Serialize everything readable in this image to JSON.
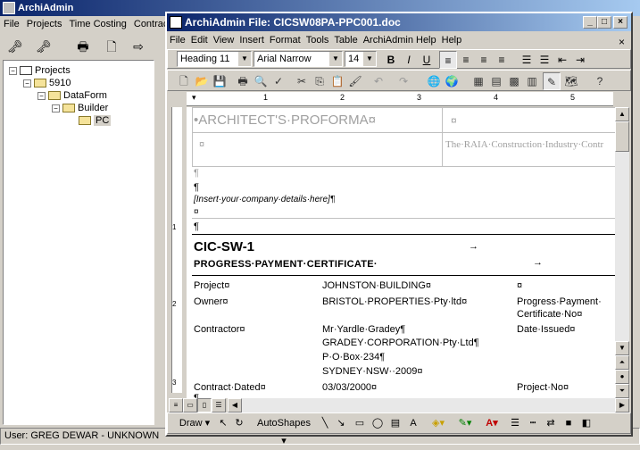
{
  "app": {
    "title": "ArchiAdmin",
    "menu": [
      "File",
      "Projects",
      "Time Costing",
      "Contract"
    ],
    "status": "User: GREG DEWAR - UNKNOWN"
  },
  "tree": {
    "items": [
      {
        "label": "Projects",
        "level": 0,
        "expander": "−"
      },
      {
        "label": "5910",
        "level": 1,
        "expander": "−"
      },
      {
        "label": "DataForm",
        "level": 2,
        "expander": "−"
      },
      {
        "label": "Builder",
        "level": 3,
        "expander": "−"
      },
      {
        "label": "PC",
        "level": 4,
        "expander": ""
      }
    ]
  },
  "word": {
    "title": "ArchiAdmin File: CICSW08PA-PPC001.doc",
    "menu": [
      "File",
      "Edit",
      "View",
      "Insert",
      "Format",
      "Tools",
      "Table",
      "ArchiAdmin Help",
      "Help"
    ],
    "style_value": "Heading 11",
    "font_value": "Arial Narrow",
    "size_value": "14",
    "ruler_numbers": [
      "1",
      "2",
      "3",
      "4",
      "5"
    ],
    "vruler_numbers": [
      "1",
      "2",
      "3"
    ],
    "draw_label": "Draw",
    "autoshapes_label": "AutoShapes"
  },
  "document": {
    "proforma_title": "•ARCHITECT'S·PROFORMA¤",
    "cell_mark": "¤",
    "raia_text": "The·RAIA·Construction·Industry·Contr",
    "pilcrow": "¶",
    "insert_details": "[Insert·your·company·details·here]¶",
    "form_code": "CIC-SW-1",
    "form_title": "PROGRESS·PAYMENT·CERTIFICATE·",
    "tab_arrow": "→",
    "rows": {
      "project_label": "Project¤",
      "project_value": "JOHNSTON·BUILDING¤",
      "owner_label": "Owner¤",
      "owner_value": "BRISTOL·PROPERTIES·Pty·ltd¤",
      "progress_label_1": "Progress·Payment·",
      "progress_label_2": "Certificate·No¤",
      "contractor_label": "Contractor¤",
      "contractor_line1": "Mr·Yardle·Gradey¶",
      "contractor_line2": "GRADEY·CORPORATION·Pty·Ltd¶",
      "contractor_line3": "P·O·Box·234¶",
      "contractor_line4": "SYDNEY·NSW··2009¤",
      "date_issued_label": "Date·Issued¤",
      "contract_dated_label": "Contract·Dated¤",
      "contract_dated_value": "03/03/2000¤",
      "project_no_label": "Project·No¤"
    }
  }
}
